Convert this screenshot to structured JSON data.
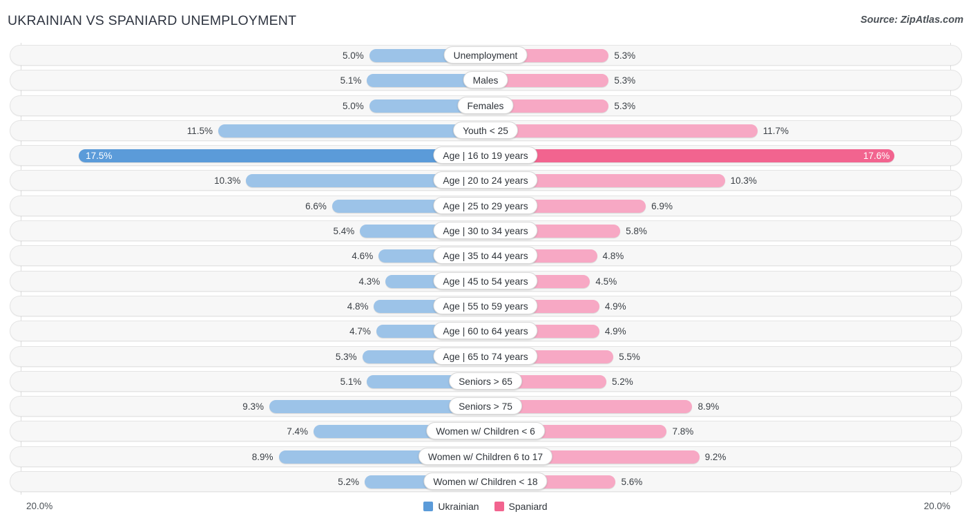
{
  "header": {
    "title": "UKRAINIAN VS SPANIARD UNEMPLOYMENT",
    "source": "Source: ZipAtlas.com"
  },
  "axis": {
    "min_label": "20.0%",
    "max_label": "20.0%",
    "max_value": 20.0
  },
  "legend": {
    "items": [
      {
        "label": "Ukrainian",
        "color": "#5b9bd9"
      },
      {
        "label": "Spaniard",
        "color": "#f2648f"
      }
    ]
  },
  "colors": {
    "left_normal": "#9cc3e8",
    "left_highlight": "#5b9bd9",
    "right_normal": "#f7a8c4",
    "right_highlight": "#f2648f",
    "track": "#f7f7f7",
    "gridline": "#dcdcdc"
  },
  "chart_data": {
    "type": "bar",
    "orientation": "horizontal-diverging",
    "title": "UKRAINIAN VS SPANIARD UNEMPLOYMENT",
    "xlabel": "",
    "ylabel": "",
    "xlim": [
      20.0,
      20.0
    ],
    "grid": true,
    "legend_position": "bottom-center",
    "categories": [
      "Unemployment",
      "Males",
      "Females",
      "Youth < 25",
      "Age | 16 to 19 years",
      "Age | 20 to 24 years",
      "Age | 25 to 29 years",
      "Age | 30 to 34 years",
      "Age | 35 to 44 years",
      "Age | 45 to 54 years",
      "Age | 55 to 59 years",
      "Age | 60 to 64 years",
      "Age | 65 to 74 years",
      "Seniors > 65",
      "Seniors > 75",
      "Women w/ Children < 6",
      "Women w/ Children 6 to 17",
      "Women w/ Children < 18"
    ],
    "series": [
      {
        "name": "Ukrainian",
        "values": [
          5.0,
          5.1,
          5.0,
          11.5,
          17.5,
          10.3,
          6.6,
          5.4,
          4.6,
          4.3,
          4.8,
          4.7,
          5.3,
          5.1,
          9.3,
          7.4,
          8.9,
          5.2
        ],
        "labels": [
          "5.0%",
          "5.1%",
          "5.0%",
          "11.5%",
          "17.5%",
          "10.3%",
          "6.6%",
          "5.4%",
          "4.6%",
          "4.3%",
          "4.8%",
          "4.7%",
          "5.3%",
          "5.1%",
          "9.3%",
          "7.4%",
          "8.9%",
          "5.2%"
        ]
      },
      {
        "name": "Spaniard",
        "values": [
          5.3,
          5.3,
          5.3,
          11.7,
          17.6,
          10.3,
          6.9,
          5.8,
          4.8,
          4.5,
          4.9,
          4.9,
          5.5,
          5.2,
          8.9,
          7.8,
          9.2,
          5.6
        ],
        "labels": [
          "5.3%",
          "5.3%",
          "5.3%",
          "11.7%",
          "17.6%",
          "10.3%",
          "6.9%",
          "5.8%",
          "4.8%",
          "4.5%",
          "4.9%",
          "4.9%",
          "5.5%",
          "5.2%",
          "8.9%",
          "7.8%",
          "9.2%",
          "5.6%"
        ]
      }
    ],
    "highlight_row_index": 4
  }
}
